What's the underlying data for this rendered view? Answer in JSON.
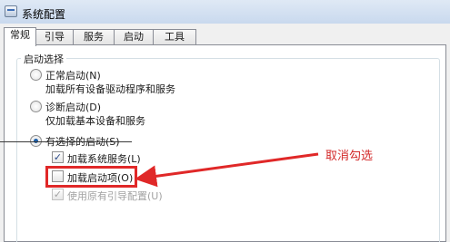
{
  "window": {
    "title": "系统配置",
    "app_icon": "msconfig-icon"
  },
  "tabs": [
    {
      "label": "常规",
      "active": true
    },
    {
      "label": "引导",
      "active": false
    },
    {
      "label": "服务",
      "active": false
    },
    {
      "label": "启动",
      "active": false
    },
    {
      "label": "工具",
      "active": false
    }
  ],
  "startup_selection": {
    "group_title": "启动选择",
    "options": [
      {
        "label": "正常启动(N)",
        "description": "加载所有设备驱动程序和服务",
        "selected": false
      },
      {
        "label": "诊断启动(D)",
        "description": "仅加载基本设备和服务",
        "selected": false
      },
      {
        "label": "有选择的启动(S)",
        "selected": true
      }
    ],
    "selective_items": [
      {
        "label": "加载系统服务(L)",
        "checked": true,
        "enabled": true
      },
      {
        "label": "加载启动项(O)",
        "checked": false,
        "enabled": true
      },
      {
        "label": "使用原有引导配置(U)",
        "checked": true,
        "enabled": false
      }
    ]
  },
  "annotation": {
    "text": "取消勾选",
    "color": "#e02828"
  }
}
